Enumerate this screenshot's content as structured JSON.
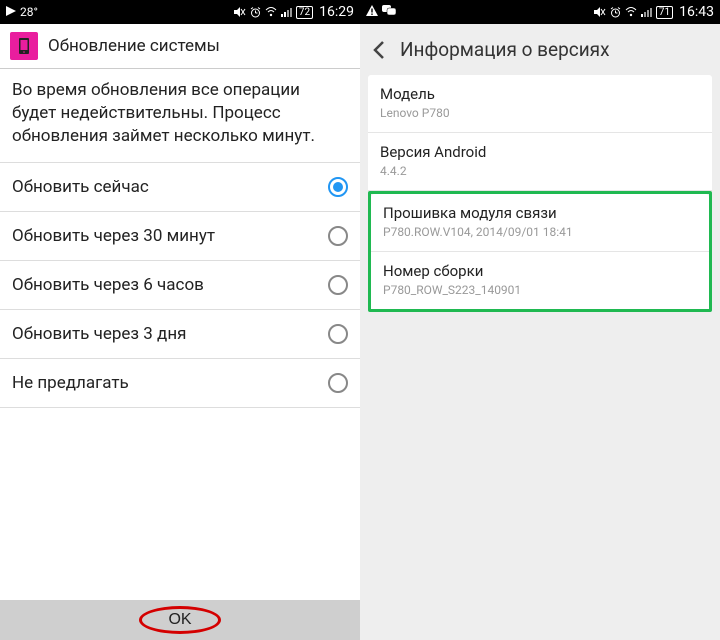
{
  "left": {
    "status": {
      "temp": "28°",
      "battery": "72",
      "time": "16:29"
    },
    "header": {
      "title": "Обновление системы"
    },
    "description": "Во время обновления все операции будет недействительны. Процесс обновления займет несколько минут.",
    "options": [
      {
        "label": "Обновить сейчас",
        "selected": true
      },
      {
        "label": "Обновить через 30 минут",
        "selected": false
      },
      {
        "label": "Обновить через 6 часов",
        "selected": false
      },
      {
        "label": "Обновить через 3 дня",
        "selected": false
      },
      {
        "label": "Не предлагать",
        "selected": false
      }
    ],
    "ok_label": "OK"
  },
  "right": {
    "status": {
      "battery": "71",
      "time": "16:43"
    },
    "header": {
      "title": "Информация о версиях"
    },
    "items": [
      {
        "title": "Модель",
        "sub": "Lenovo P780"
      },
      {
        "title": "Версия Android",
        "sub": "4.4.2"
      },
      {
        "title": "Прошивка модуля связи",
        "sub": "P780.ROW.V104, 2014/09/01 18:41"
      },
      {
        "title": "Номер сборки",
        "sub": "P780_ROW_S223_140901"
      }
    ]
  }
}
